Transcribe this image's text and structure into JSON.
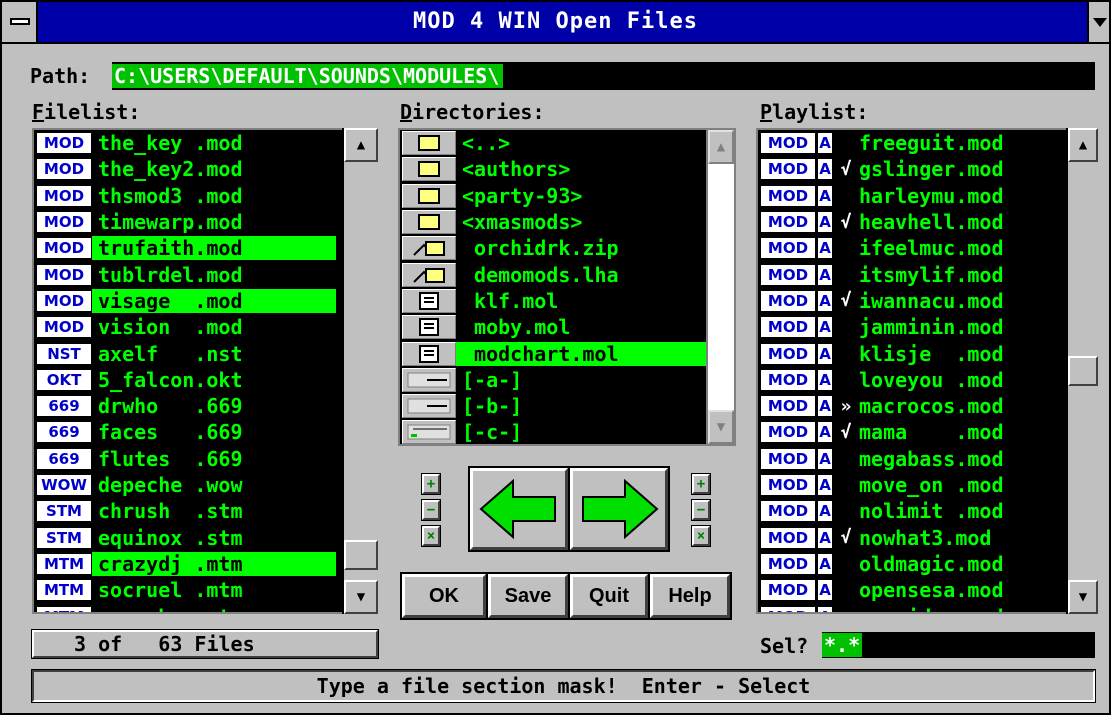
{
  "window": {
    "title": "MOD 4 WIN Open Files"
  },
  "path": {
    "label": "Path:",
    "value": "C:\\USERS\\DEFAULT\\SOUNDS\\MODULES\\"
  },
  "filelist": {
    "label_key": "F",
    "label_rest": "ilelist:",
    "items": [
      {
        "type": "MOD",
        "name": "the_key .mod",
        "selected": false
      },
      {
        "type": "MOD",
        "name": "the_key2.mod",
        "selected": false
      },
      {
        "type": "MOD",
        "name": "thsmod3 .mod",
        "selected": false
      },
      {
        "type": "MOD",
        "name": "timewarp.mod",
        "selected": false
      },
      {
        "type": "MOD",
        "name": "trufaith.mod",
        "selected": true
      },
      {
        "type": "MOD",
        "name": "tublrdel.mod",
        "selected": false
      },
      {
        "type": "MOD",
        "name": "visage  .mod",
        "selected": true
      },
      {
        "type": "MOD",
        "name": "vision  .mod",
        "selected": false
      },
      {
        "type": "NST",
        "name": "axelf   .nst",
        "selected": false
      },
      {
        "type": "OKT",
        "name": "5_falcon.okt",
        "selected": false
      },
      {
        "type": "669",
        "name": "drwho   .669",
        "selected": false
      },
      {
        "type": "669",
        "name": "faces   .669",
        "selected": false
      },
      {
        "type": "669",
        "name": "flutes  .669",
        "selected": false
      },
      {
        "type": "WOW",
        "name": "depeche .wow",
        "selected": false
      },
      {
        "type": "STM",
        "name": "chrush  .stm",
        "selected": false
      },
      {
        "type": "STM",
        "name": "equinox .stm",
        "selected": false
      },
      {
        "type": "MTM",
        "name": "crazydj .mtm",
        "selected": true
      },
      {
        "type": "MTM",
        "name": "socruel .mtm",
        "selected": false
      },
      {
        "type": "MTM",
        "name": "swesober.mtm",
        "selected": false
      }
    ],
    "scroll_up_icon": "arrow-up-icon",
    "scroll_down_icon": "arrow-down-icon"
  },
  "directories": {
    "label_key": "D",
    "label_rest": "irectories:",
    "items": [
      {
        "icon": "folder-icon",
        "name": "<..>",
        "selected": false
      },
      {
        "icon": "folder-icon",
        "name": "<authors>",
        "selected": false
      },
      {
        "icon": "folder-icon",
        "name": "<party-93>",
        "selected": false
      },
      {
        "icon": "folder-icon",
        "name": "<xmasmods>",
        "selected": false
      },
      {
        "icon": "archive-icon",
        "name": " orchidrk.zip",
        "selected": false
      },
      {
        "icon": "archive-icon",
        "name": " demomods.lha",
        "selected": false
      },
      {
        "icon": "document-icon",
        "name": " klf.mol",
        "selected": false
      },
      {
        "icon": "document-icon",
        "name": " moby.mol",
        "selected": false
      },
      {
        "icon": "document-icon",
        "name": " modchart.mol",
        "selected": true
      },
      {
        "icon": "floppy-drive-icon",
        "name": "[-a-]",
        "selected": false
      },
      {
        "icon": "floppy-drive-icon",
        "name": "[-b-]",
        "selected": false
      },
      {
        "icon": "hard-drive-icon",
        "name": "[-c-]",
        "selected": false
      }
    ]
  },
  "playlist": {
    "label_key": "P",
    "label_rest": "laylist:",
    "items": [
      {
        "type": "MOD",
        "flag": "A",
        "mark": "",
        "name": "freeguit.mod"
      },
      {
        "type": "MOD",
        "flag": "A",
        "mark": "√",
        "name": "gslinger.mod"
      },
      {
        "type": "MOD",
        "flag": "A",
        "mark": "",
        "name": "harleymu.mod"
      },
      {
        "type": "MOD",
        "flag": "A",
        "mark": "√",
        "name": "heavhell.mod"
      },
      {
        "type": "MOD",
        "flag": "A",
        "mark": "",
        "name": "ifeelmuc.mod"
      },
      {
        "type": "MOD",
        "flag": "A",
        "mark": "",
        "name": "itsmylif.mod"
      },
      {
        "type": "MOD",
        "flag": "A",
        "mark": "√",
        "name": "iwannacu.mod"
      },
      {
        "type": "MOD",
        "flag": "A",
        "mark": "",
        "name": "jamminin.mod"
      },
      {
        "type": "MOD",
        "flag": "A",
        "mark": "",
        "name": "klisje  .mod"
      },
      {
        "type": "MOD",
        "flag": "A",
        "mark": "",
        "name": "loveyou .mod"
      },
      {
        "type": "MOD",
        "flag": "A",
        "mark": "»",
        "name": "macrocos.mod"
      },
      {
        "type": "MOD",
        "flag": "A",
        "mark": "√",
        "name": "mama    .mod"
      },
      {
        "type": "MOD",
        "flag": "A",
        "mark": "",
        "name": "megabass.mod"
      },
      {
        "type": "MOD",
        "flag": "A",
        "mark": "",
        "name": "move_on .mod"
      },
      {
        "type": "MOD",
        "flag": "A",
        "mark": "",
        "name": "nolimit .mod"
      },
      {
        "type": "MOD",
        "flag": "A",
        "mark": "√",
        "name": "nowhat3.mod"
      },
      {
        "type": "MOD",
        "flag": "A",
        "mark": "",
        "name": "oldmagic.mod"
      },
      {
        "type": "MOD",
        "flag": "A",
        "mark": "",
        "name": "opensesa.mod"
      },
      {
        "type": "MOD",
        "flag": "A",
        "mark": "",
        "name": "poseidon.mod"
      }
    ]
  },
  "buttons": {
    "ok": "OK",
    "save": "Save",
    "quit": "Quit",
    "help": "Help",
    "plus": "+",
    "minus": "−",
    "remove": "×"
  },
  "file_count": "3 of   63 Files",
  "selection": {
    "label": "Sel?",
    "value": "*.*"
  },
  "status": "Type a file section mask!  Enter - Select",
  "colors": {
    "title_bar": "#0000a8",
    "list_bg": "#000000",
    "list_text": "#00ff00",
    "highlight": "#00ff00",
    "window_bg": "#c0c0c0"
  }
}
